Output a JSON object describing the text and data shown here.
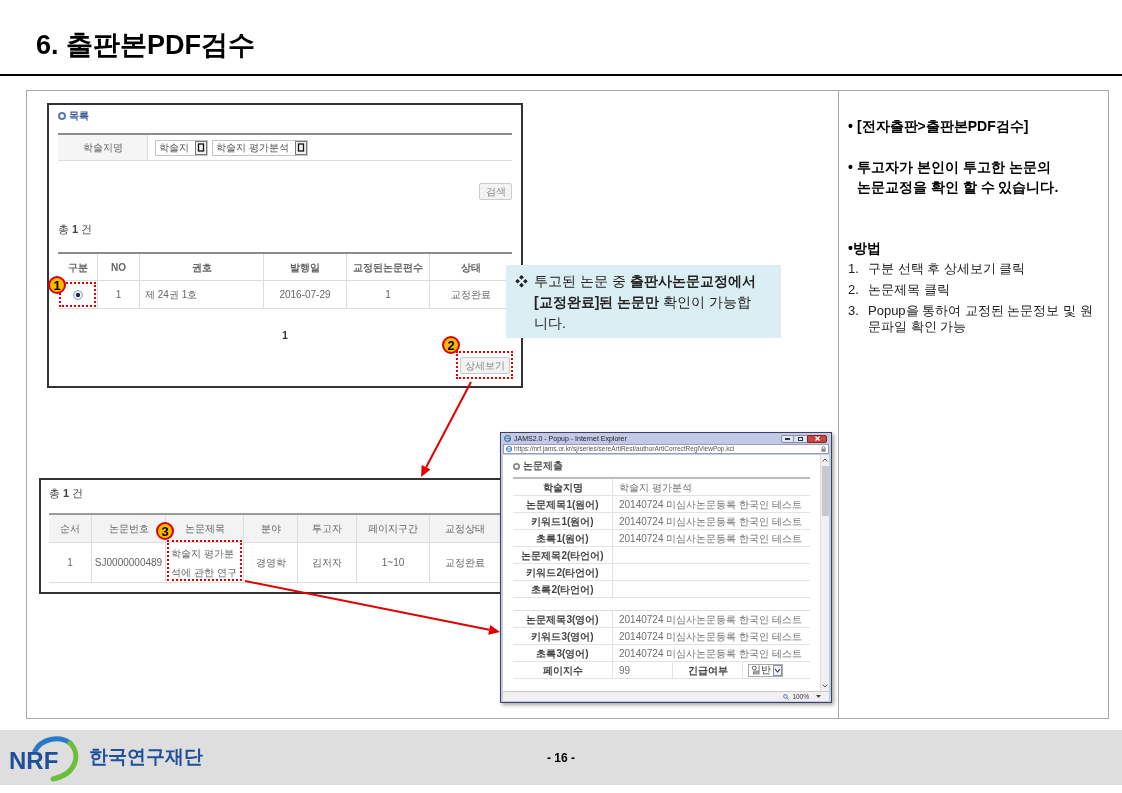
{
  "title": "6. 출판본PDF검수",
  "list_screen": {
    "section_title": "목록",
    "search_label": "학술지명",
    "selects": [
      {
        "value": "학술지"
      },
      {
        "value": "학술지 평가분석"
      }
    ],
    "search_button": "검색",
    "total": "총 **1** 건",
    "columns": [
      "구분",
      "NO",
      "권호",
      "발행일",
      "교정된논문편수",
      "상태"
    ],
    "rows": [
      {
        "selected": true,
        "cells": [
          "",
          "1",
          "제 24권 1호",
          "2016-07-29",
          "1",
          "교정완료"
        ]
      }
    ],
    "page": "1",
    "detail_button": "상세보기",
    "select_marker": "1",
    "detail_marker": "2"
  },
  "callout": {
    "symbol": "❖",
    "text": "투고된 논문 중 **출판사논문교정에서 [교정완료]된 논문만** 확인이 가능합니다."
  },
  "result_screen": {
    "total": "총 **1** 건",
    "columns": [
      "순서",
      "논문번호",
      "논문제목",
      "분야",
      "투고자",
      "페이지구간",
      "교정상태"
    ],
    "rows": [
      {
        "cells": [
          "1",
          "SJ0000000489",
          "학술지 평가분석에 관한 연구",
          "경영학",
          "김저자",
          "1~10",
          "교정완료"
        ]
      }
    ],
    "title_marker": "3"
  },
  "popup": {
    "window_title": "JAMS2.0 - Popup - Internet Explorer",
    "address": "https://nrf.jams.or.kr/sj/series/sereArtiRest/authorArtiCorrectRegiViewPop.kci",
    "section_title": "논문제출",
    "groups": [
      {
        "rows": [
          {
            "kind": "text",
            "label": "학술지명",
            "value": "학술지 평가분석"
          },
          {
            "kind": "text",
            "label": "논문제목1(원어)",
            "value": "20140724 미심사논문등록 한국인 테스트"
          },
          {
            "kind": "text",
            "label": "키워드1(원어)",
            "value": "20140724 미심사논문등록 한국인 테스트"
          },
          {
            "kind": "text",
            "label": "초록1(원어)",
            "value": "20140724 미심사논문등록 한국인 테스트"
          },
          {
            "kind": "text",
            "label": "논문제목2(타언어)"
          },
          {
            "kind": "text",
            "label": "키워드2(타언어)"
          },
          {
            "kind": "text",
            "label": "초록2(타언어)"
          }
        ]
      },
      {
        "rows": [
          {
            "kind": "text",
            "label": "논문제목3(영어)",
            "value": "20140724 미심사논문등록 한국인 테스트"
          },
          {
            "kind": "text",
            "label": "키워드3(영어)",
            "value": "20140724 미심사논문등록 한국인 테스트"
          },
          {
            "kind": "text",
            "label": "초록3(영어)",
            "value": "20140724 미심사논문등록 한국인 테스트"
          },
          {
            "kind": "split",
            "label": "페이지수",
            "value": "99",
            "label_2": "긴급여부",
            "select": "일반"
          }
        ]
      }
    ],
    "zoom": "100%"
  },
  "notes": {
    "items": [
      {
        "bullet": "•",
        "text": "[전자출판>출판본PDF검수]"
      },
      {
        "bullet": "•",
        "text": "투고자가 본인이 투고한 논문의 논문교정을 확인 할 수 있습니다."
      }
    ],
    "method": {
      "bullet": "•",
      "title": "방법",
      "steps": [
        {
          "number": "1.",
          "text": "구분 선택 후 상세보기 클릭"
        },
        {
          "number": "2.",
          "text": "논문제목 클릭"
        },
        {
          "number": "3.",
          "text": "Popup을 통하여 교정된 논문정보 및 원문파일 확인 가능"
        }
      ]
    }
  },
  "footer": {
    "logo_text": "NRF",
    "org_name": "한국연구재단",
    "page_number": "- 16 -"
  }
}
